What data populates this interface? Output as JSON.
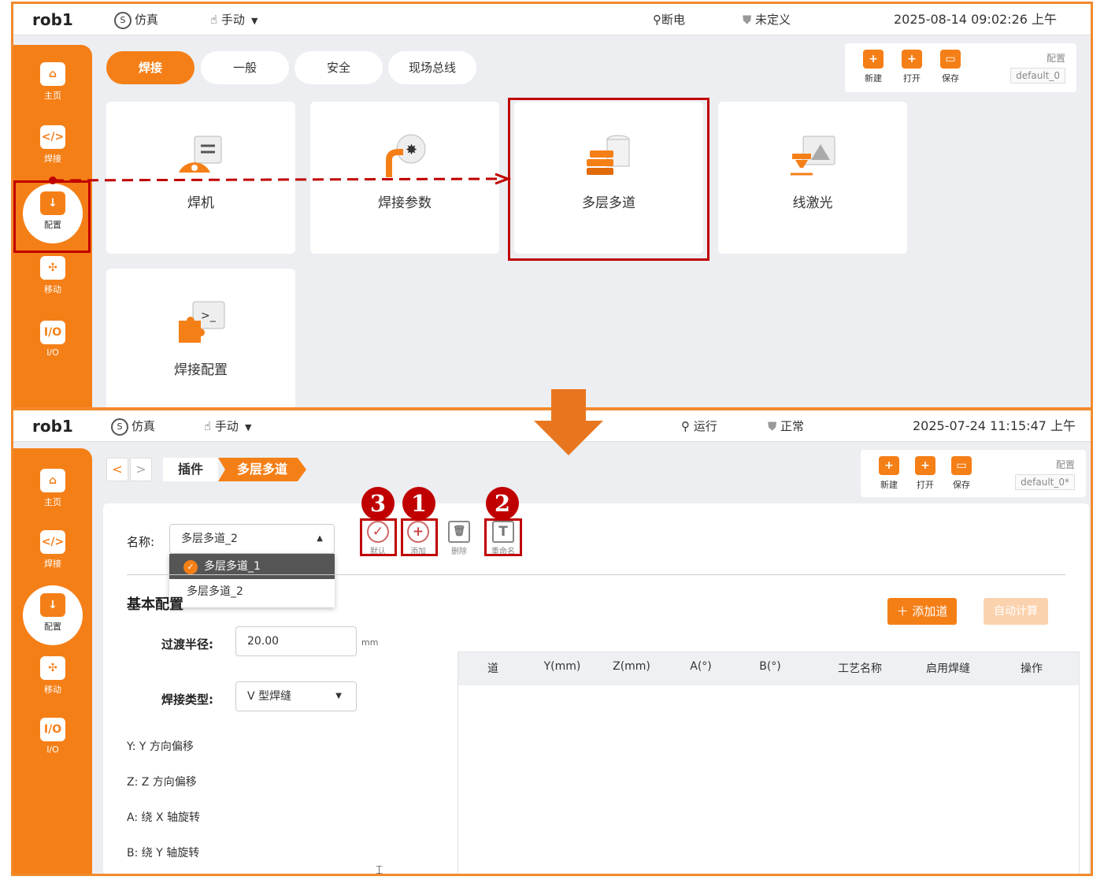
{
  "panel1": {
    "topbar": {
      "robot": "rob1",
      "mode": "仿真",
      "mode_icon": "S",
      "control": "手动",
      "power": "断电",
      "safety": "未定义",
      "datetime": "2025-08-14 09:02:26 上午"
    },
    "sidebar": [
      {
        "icon": "home-icon",
        "label": "主页"
      },
      {
        "icon": "code-icon",
        "glyph": "</>",
        "label": "焊接"
      },
      {
        "icon": "config-icon",
        "glyph": "↓",
        "label": "配置"
      },
      {
        "icon": "move-icon",
        "glyph": "✣",
        "label": "移动"
      },
      {
        "icon": "io-icon",
        "glyph": "I/O",
        "label": "I/O"
      }
    ],
    "tabs": [
      "焊接",
      "一般",
      "安全",
      "现场总线"
    ],
    "file": {
      "new": "新建",
      "open": "打开",
      "save": "保存",
      "config_label": "配置",
      "config_value": "default_0"
    },
    "cards": [
      "焊机",
      "焊接参数",
      "多层多道",
      "线激光",
      "焊接配置"
    ]
  },
  "panel2": {
    "topbar": {
      "robot": "rob1",
      "mode": "仿真",
      "mode_icon": "S",
      "control": "手动",
      "power": "运行",
      "safety": "正常",
      "datetime": "2025-07-24 11:15:47 上午"
    },
    "sidebar": [
      {
        "icon": "home-icon",
        "label": "主页"
      },
      {
        "icon": "code-icon",
        "glyph": "</>",
        "label": "焊接"
      },
      {
        "icon": "config-icon",
        "glyph": "↓",
        "label": "配置"
      },
      {
        "icon": "move-icon",
        "glyph": "✣",
        "label": "移动"
      },
      {
        "icon": "io-icon",
        "glyph": "I/O",
        "label": "I/O"
      }
    ],
    "breadcrumb": {
      "back": "<",
      "forward": ">",
      "parent": "插件",
      "current": "多层多道"
    },
    "file": {
      "new": "新建",
      "open": "打开",
      "save": "保存",
      "config_label": "配置",
      "config_value": "default_0*"
    },
    "name_label": "名称:",
    "name_value": "多层多道_2",
    "dropdown": [
      {
        "label": "多层多道_1",
        "selected": true
      },
      {
        "label": "多层多道_2",
        "selected": false
      }
    ],
    "tools": [
      {
        "icon": "check-circle-icon",
        "glyph": "✓",
        "label": "默认"
      },
      {
        "icon": "plus-circle-icon",
        "glyph": "+",
        "label": "添加"
      },
      {
        "icon": "trash-icon",
        "glyph": "🗑",
        "label": "删除"
      },
      {
        "icon": "rename-icon",
        "glyph": "T",
        "label": "重命名"
      }
    ],
    "badges": [
      "3",
      "1",
      "2"
    ],
    "section_title": "基本配置",
    "radius_label": "过渡半径:",
    "radius_value": "20.00",
    "radius_unit": "mm",
    "weld_type_label": "焊接类型:",
    "weld_type_value": "V 型焊缝",
    "hints": [
      "Y:  Y 方向偏移",
      "Z:  Z 方向偏移",
      "A:  绕 X 轴旋转",
      "B:  绕 Y 轴旋转"
    ],
    "add_pass": "＋ 添加道",
    "auto_calc": "自动计算",
    "table_headers": [
      "道",
      "Y(mm)",
      "Z(mm)",
      "A(°)",
      "B(°)",
      "工艺名称",
      "启用焊缝",
      "操作"
    ]
  },
  "colors": {
    "accent": "#f57f17",
    "annotation": "#c00000",
    "arrow": "#e8761f"
  }
}
